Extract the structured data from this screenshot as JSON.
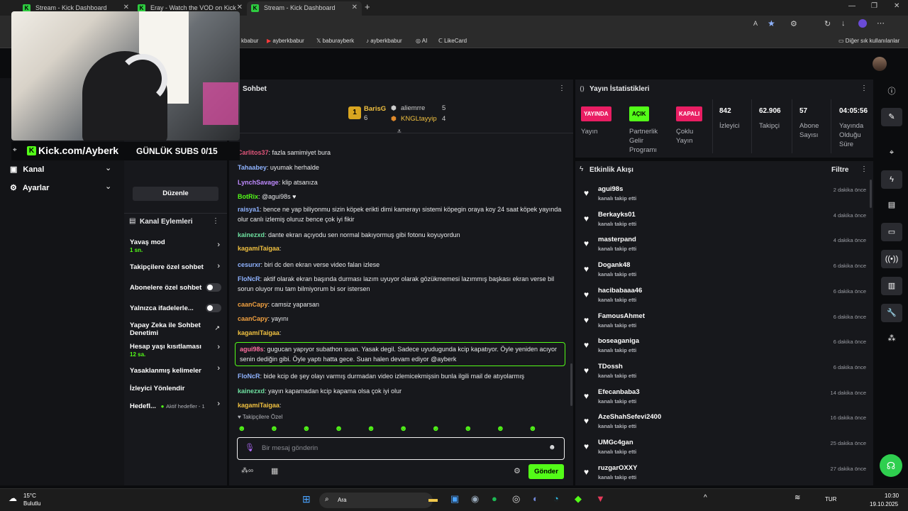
{
  "browser": {
    "tabs": [
      {
        "label": "Stream - Kick Dashboard"
      },
      {
        "label": "Eray - Watch the VOD on Kick"
      },
      {
        "label": "Stream - Kick Dashboard"
      }
    ],
    "bookmarks": [
      "kbabur",
      "ayberkbabur",
      "baburayberk",
      "ayberkbabur",
      "AI",
      "LikeCard"
    ],
    "other_bookmarks": "Diğer sık kullanılanlar"
  },
  "overlay": {
    "kick_label": "Kick.com/Ayberk",
    "subs_goal": "GÜNLÜK SUBS 0/15"
  },
  "leftnav": {
    "items": [
      {
        "label": "Kanal"
      },
      {
        "label": "Ayarlar"
      }
    ],
    "edit_button": "Düzenle"
  },
  "channel_actions": {
    "title": "Kanal Eylemleri",
    "items": [
      {
        "label": "Yavaş mod",
        "sub": "1 sn."
      },
      {
        "label": "Takipçilere özel sohbet",
        "sub": ""
      },
      {
        "label": "Abonelere özel sohbet",
        "sub": ""
      },
      {
        "label": "Yalnızca ifadelerle...",
        "sub": ""
      },
      {
        "label": "Yapay Zeka ile Sohbet Denetimi",
        "sub": ""
      },
      {
        "label": "Hesap yaşı kısıtlaması",
        "sub": "12 sa."
      },
      {
        "label": "Yasaklanmış kelimeler",
        "sub": ""
      },
      {
        "label": "İzleyici Yönlendir",
        "sub": ""
      },
      {
        "label": "Hedefl...",
        "sub": ""
      }
    ],
    "goal_extra": "Aktif hedefler - 1"
  },
  "chat": {
    "title": "Sohbet",
    "leaders": [
      {
        "name": "BarisG",
        "count": "6"
      },
      {
        "name": "aliemrre",
        "count": "5"
      },
      {
        "name": "KNGLtayyip",
        "count": "4"
      }
    ],
    "messages": [
      {
        "user": "Carlitos37",
        "color": "#e0557a",
        "text": ": fazla samimiyet bura"
      },
      {
        "user": "Tahaabey",
        "color": "#8fb3ff",
        "text": ": uyumak herhalde"
      },
      {
        "user": "LynchSavage",
        "color": "#c08bff",
        "text": ": klip atsanıza"
      },
      {
        "user": "BotRix",
        "color": "#53fc18",
        "text": ": @agui98s ♥"
      },
      {
        "user": "raisya1",
        "color": "#8fb3ff",
        "text": ": bence ne yap biliyonmu sizin köpek erikti dimi kamerayı sistemi köpegin oraya koy 24 saat köpek yayında olur canlı izlemiş oluruz bence çok iyi fikir"
      },
      {
        "user": "kainezxd",
        "color": "#6ee0a0",
        "text": ": dante ekran açıyodu sen normal bakıyormuş gibi fotonu koyuyordun"
      },
      {
        "user": "kagamiTaigaa",
        "color": "#f0c040",
        "text": ":"
      },
      {
        "user": "cesurxr",
        "color": "#8fb3ff",
        "text": ": biri dc den ekran verse video falan izlese"
      },
      {
        "user": "FloNcR",
        "color": "#8fb3ff",
        "text": ": aktif olarak ekran başında durması lazım uyuyor olarak gözükmemesi lazımmış başkası ekran verse bil sorun oluyor mu tam bilmiyorum bi sor istersen"
      },
      {
        "user": "caanCapy",
        "color": "#f0a040",
        "text": ": camsiz yaparsan"
      },
      {
        "user": "caanCapy",
        "color": "#f0a040",
        "text": ": yayını"
      },
      {
        "user": "kagamiTaigaa",
        "color": "#f0c040",
        "text": ":"
      },
      {
        "user": "agui98s",
        "color": "#ff6fa0",
        "text": ": gugucan yapıyor subathon suan. Yasak degil. Sadece uyudugunda kcip kapatıyor. Öyle yeniden acıyor senin dediğin gibi. Öyle yaptı hatta gece. Suan halen devam ediyor @ayberk"
      },
      {
        "user": "FloNcR",
        "color": "#8fb3ff",
        "text": ": bide kcip de şey olayı varmış durmadan video izlemicekmişsin bunla ilgili mail de atıyolarmış"
      },
      {
        "user": "kainezxd",
        "color": "#6ee0a0",
        "text": ": yayın kapamadan kcip kapama olsa çok iyi olur"
      },
      {
        "user": "kagamiTaigaa",
        "color": "#f0c040",
        "text": ":"
      }
    ],
    "followers_only": "Takipçilere Özel",
    "input_placeholder": "Bir mesaj gönderin",
    "send_label": "Gönder"
  },
  "stats": {
    "title": "Yayın İstatistikleri",
    "live_badge": "YAYINDA",
    "live_label": "Yayın",
    "partner_badge": "AÇIK",
    "partner_label": "Partnerlik Gelir Programı",
    "multi_badge": "KAPALI",
    "multi_label": "Çoklu Yayın",
    "viewers": {
      "value": "842",
      "label": "İzleyici"
    },
    "followers": {
      "value": "62.906",
      "label": "Takipçi"
    },
    "subs": {
      "value": "57",
      "label": "Abone Sayısı"
    },
    "uptime": {
      "value": "04:05:56",
      "label": "Yayında Olduğu Süre"
    }
  },
  "events": {
    "title": "Etkinlik Akışı",
    "filter": "Filtre",
    "items": [
      {
        "name": "agui98s",
        "action": "kanalı takip etti",
        "time": "2 dakika önce"
      },
      {
        "name": "Berkayks01",
        "action": "kanalı takip etti",
        "time": "4 dakika önce"
      },
      {
        "name": "masterpand",
        "action": "kanalı takip etti",
        "time": "4 dakika önce"
      },
      {
        "name": "Dogank48",
        "action": "kanalı takip etti",
        "time": "6 dakika önce"
      },
      {
        "name": "hacibabaaa46",
        "action": "kanalı takip etti",
        "time": "6 dakika önce"
      },
      {
        "name": "FamousAhmet",
        "action": "kanalı takip etti",
        "time": "6 dakika önce"
      },
      {
        "name": "boseaganiga",
        "action": "kanalı takip etti",
        "time": "6 dakika önce"
      },
      {
        "name": "TDossh",
        "action": "kanalı takip etti",
        "time": "6 dakika önce"
      },
      {
        "name": "Efecanbaba3",
        "action": "kanalı takip etti",
        "time": "14 dakika önce"
      },
      {
        "name": "AzeShahSefevi2400",
        "action": "kanalı takip etti",
        "time": "16 dakika önce"
      },
      {
        "name": "UMGc4gan",
        "action": "kanalı takip etti",
        "time": "25 dakika önce"
      },
      {
        "name": "ruzgarOXXY",
        "action": "kanalı takip etti",
        "time": "27 dakika önce"
      }
    ]
  },
  "taskbar": {
    "weather_temp": "15°C",
    "weather_desc": "Bulutlu",
    "search": "Ara",
    "lang": "TUR",
    "time": "10:30",
    "date": "19.10.2025"
  },
  "colors": {
    "accent": "#53fc18",
    "live": "#e91e63",
    "panel": "#17181c"
  }
}
